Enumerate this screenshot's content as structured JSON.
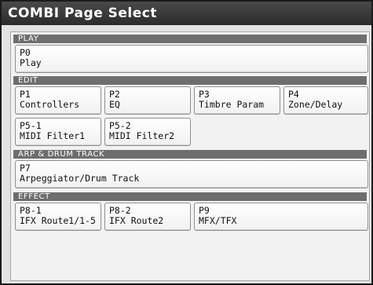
{
  "window": {
    "title": "COMBI  Page Select"
  },
  "sections": {
    "play": {
      "header": "PLAY",
      "pages": [
        {
          "id": "P0",
          "name": "Play"
        }
      ]
    },
    "edit": {
      "header": "EDIT",
      "pages": [
        {
          "id": "P1",
          "name": "Controllers"
        },
        {
          "id": "P2",
          "name": "EQ"
        },
        {
          "id": "P3",
          "name": "Timbre Param"
        },
        {
          "id": "P4",
          "name": "Zone/Delay"
        },
        {
          "id": "P5-1",
          "name": "MIDI Filter1"
        },
        {
          "id": "P5-2",
          "name": "MIDI Filter2"
        }
      ]
    },
    "arp": {
      "header": "ARP & DRUM TRACK",
      "pages": [
        {
          "id": "P7",
          "name": "Arpeggiator/Drum Track"
        }
      ]
    },
    "effect": {
      "header": "EFFECT",
      "pages": [
        {
          "id": "P8-1",
          "name": "IFX Route1/1-5"
        },
        {
          "id": "P8-2",
          "name": "IFX Route2"
        },
        {
          "id": "P9",
          "name": "MFX/TFX"
        }
      ]
    }
  }
}
